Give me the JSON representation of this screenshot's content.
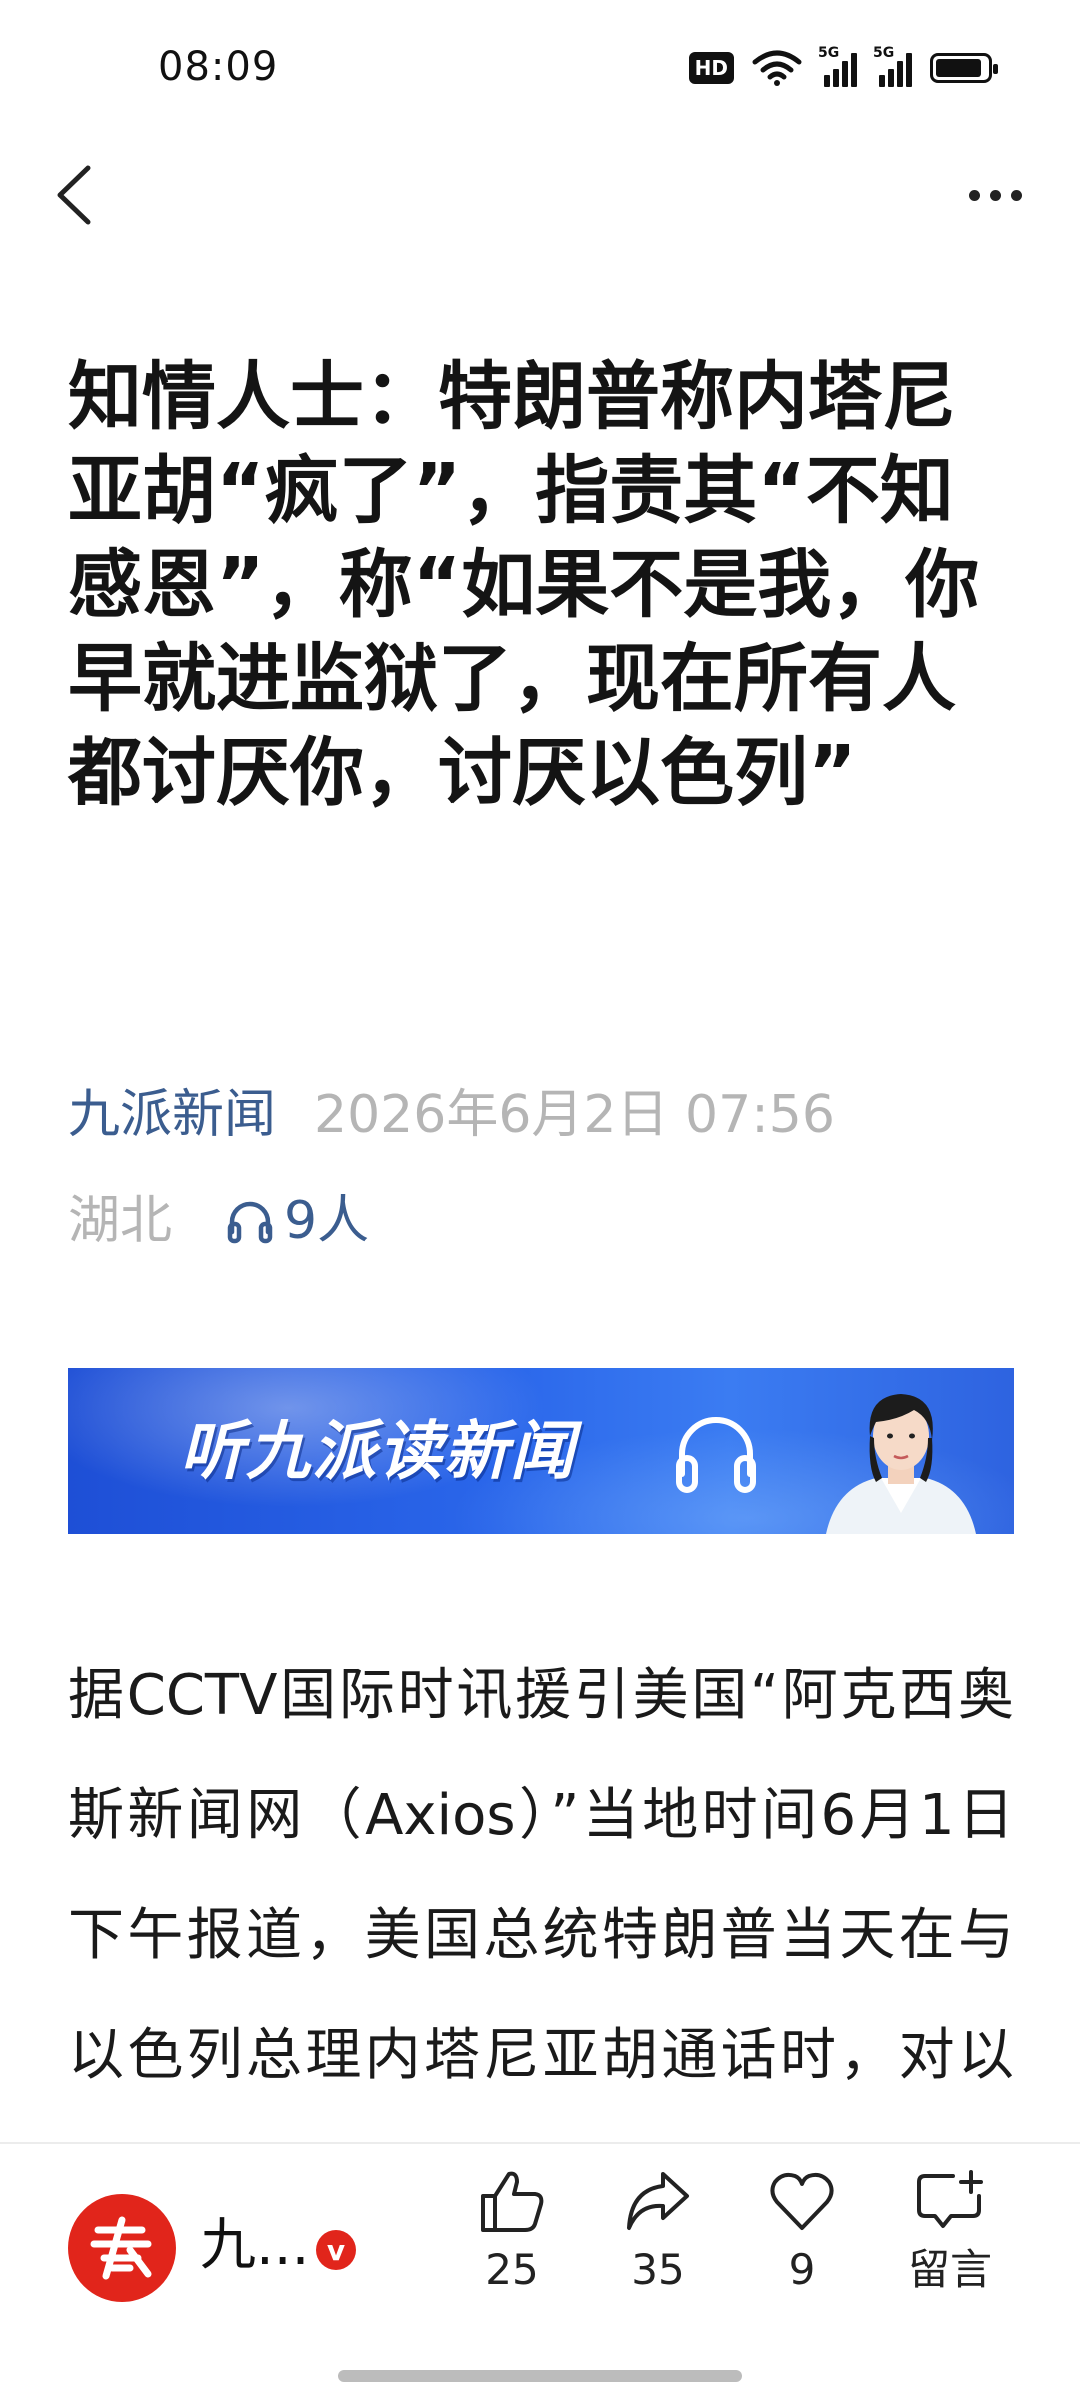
{
  "status_bar": {
    "time": "08:09",
    "hd_label": "HD",
    "network_1": "5G",
    "network_2": "5G",
    "battery_level": 0.9
  },
  "nav": {
    "back_icon": "chevron-left-icon",
    "more_icon": "more-horizontal-icon"
  },
  "article": {
    "title": "知情人士：特朗普称内塔尼亚胡“疯了”，指责其“不知感恩”，称“如果不是我，你早就进监狱了，现在所有人都讨厌你，讨厌以色列”",
    "source": "九派新闻",
    "date": "2026年6月2日 07:56",
    "location": "湖北",
    "listeners": "9人",
    "banner_text": "听九派读新闻",
    "body": "据CCTV国际时讯援引美国“阿克西奥斯新闻网（Axios）”当地时间6月1日下午报道，美国总统特朗普当天在与以色列总理内塔尼亚胡通话时，对以色列升级黎巴嫩局势表示"
  },
  "bottom_bar": {
    "publisher_name": "九...",
    "verified_mark": "v",
    "like_count": "25",
    "share_count": "35",
    "favorite_count": "9",
    "comment_label": "留言"
  },
  "colors": {
    "source_blue": "#3b5d8f",
    "meta_gray": "#b5b5b5",
    "brand_red": "#e1251b",
    "banner_blue": "#2a66ea"
  }
}
